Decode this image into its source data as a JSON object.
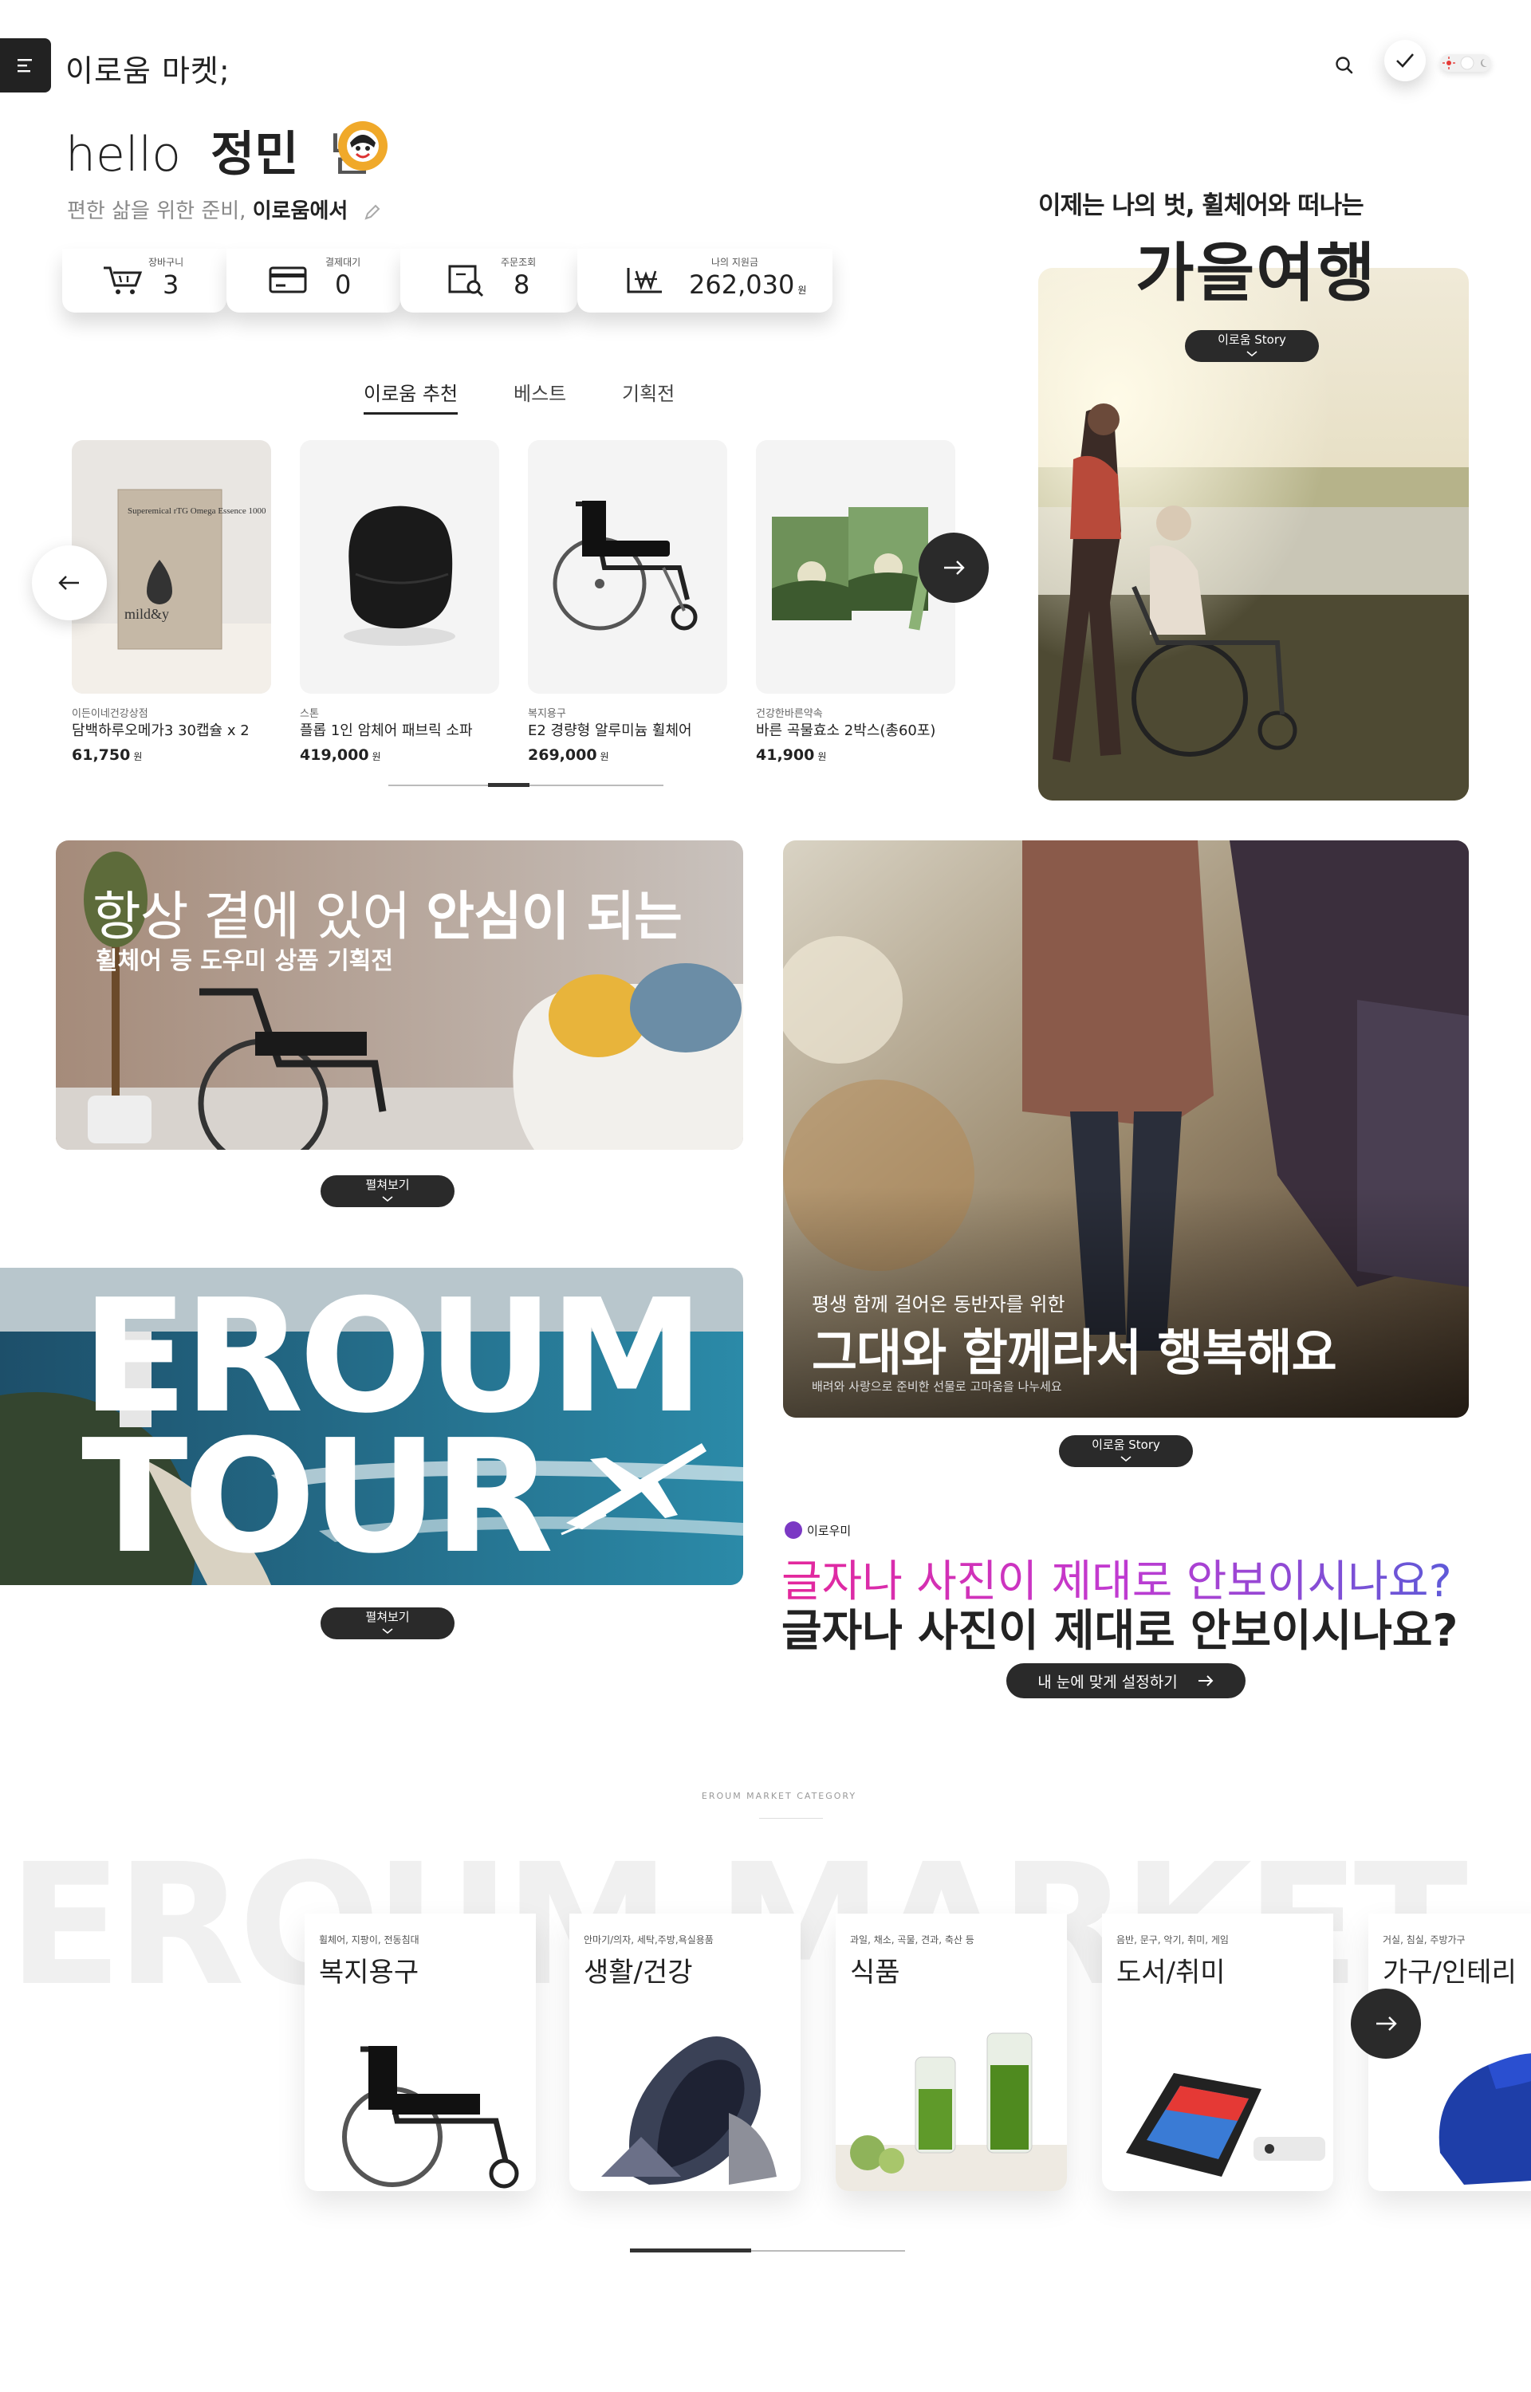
{
  "header": {
    "brand": "이로움 마켓;",
    "icons": [
      "menu-icon",
      "search-icon",
      "check-icon",
      "toggle-icon"
    ]
  },
  "greeting": {
    "hello": "hello",
    "name": "정민",
    "suffix": "님",
    "subtitle_prefix": "편한 삶을 위한 준비,",
    "subtitle_bold": "이로움에서"
  },
  "stats": [
    {
      "label": "장바구니",
      "value": "3",
      "unit": "",
      "icon": "cart-icon"
    },
    {
      "label": "결제대기",
      "value": "0",
      "unit": "",
      "icon": "card-icon"
    },
    {
      "label": "주문조회",
      "value": "8",
      "unit": "",
      "icon": "order-search-icon"
    },
    {
      "label": "나의 지원금",
      "value": "262,030",
      "unit": "원",
      "icon": "won-icon"
    }
  ],
  "tabs": [
    "이로움 추천",
    "베스트",
    "기획전"
  ],
  "products": [
    {
      "category": "이든이네건강상점",
      "name": "담백하루오메가3 30캡슐 x 2",
      "price": "61,750",
      "unit": "원",
      "image_text": "Superemical rTG Omega Essence 1000",
      "image_brand": "mild&y"
    },
    {
      "category": "스톤",
      "name": "플롭 1인 암체어 패브릭 소파",
      "price": "419,000",
      "unit": "원"
    },
    {
      "category": "복지용구",
      "name": "E2 경량형 알루미늄 휠체어",
      "price": "269,000",
      "unit": "원"
    },
    {
      "category": "건강한바른약속",
      "name": "바른 곡물효소 2박스(총60포)",
      "price": "41,900",
      "unit": "원"
    }
  ],
  "autumn": {
    "line1": "이제는 나의 벗, 휠체어와 떠나는",
    "line2": "가을여행",
    "button": "이로움 Story"
  },
  "wheelchair_banner": {
    "line1_light": "항상 곁에 있어",
    "line1_bold": "안심이 되는",
    "line2": "휠체어 등 도우미 상품 기획전",
    "button": "펼쳐보기"
  },
  "walk_banner": {
    "line1": "평생 함께 걸어온 동반자를 위한",
    "line2": "그대와 함께라서 행복해요",
    "line3": "배려와 사랑으로 준비한 선물로 고마움을 나누세요",
    "button": "이로움 Story"
  },
  "tour_banner": {
    "word1": "EROUM",
    "word2": "TOUR",
    "button": "펼쳐보기"
  },
  "eroumi": {
    "badge": "이로우미",
    "line_gradient": "글자나 사진이 제대로 안보이시나요?",
    "line_bold": "글자나 사진이 제대로 안보이시나요?",
    "button": "내 눈에 맞게 설정하기"
  },
  "category": {
    "eyebrow": "EROUM MARKET CATEGORY",
    "big": "EROUM MARKET",
    "items": [
      {
        "sub": "휠체어, 지팡이, 전동침대",
        "name": "복지용구"
      },
      {
        "sub": "안마기/의자, 세탁,주방,욕실용품",
        "name": "생활/건강"
      },
      {
        "sub": "과일, 채소, 곡물, 견과, 축산 등",
        "name": "식품"
      },
      {
        "sub": "음반, 문구, 악기, 취미, 게임",
        "name": "도서/취미"
      },
      {
        "sub": "거실, 침실, 주방가구",
        "name": "가구/인테리"
      }
    ]
  },
  "colors": {
    "dark": "#2a2a2a",
    "accent_orange": "#f0a92a",
    "gradient_pink": "#e4279b",
    "gradient_blue": "#5e5ad8",
    "eroumi_purple": "#7b39c4"
  }
}
